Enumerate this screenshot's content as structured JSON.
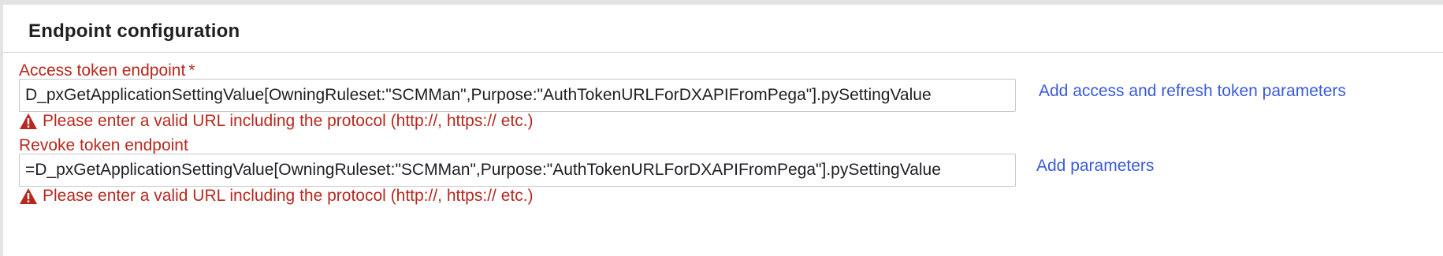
{
  "panel": {
    "title": "Endpoint configuration"
  },
  "access_token": {
    "label": "Access token endpoint",
    "required_marker": "*",
    "value": "D_pxGetApplicationSettingValue[OwningRuleset:\"SCMMan\",Purpose:\"AuthTokenURLForDXAPIFromPega\"].pySettingValue",
    "error": "Please enter a valid URL including the protocol (http://, https:// etc.)",
    "link": "Add access and refresh token parameters"
  },
  "revoke_token": {
    "label": "Revoke token endpoint",
    "value": "=D_pxGetApplicationSettingValue[OwningRuleset:\"SCMMan\",Purpose:\"AuthTokenURLForDXAPIFromPega\"].pySettingValue",
    "error": "Please enter a valid URL including the protocol (http://, https:// etc.)",
    "link": "Add parameters"
  },
  "icons": {
    "error": "warning-triangle-icon"
  },
  "colors": {
    "error": "#b8281e",
    "link": "#3a5bd9",
    "heading": "#1f1f24",
    "frame": "#e3e3e6"
  }
}
